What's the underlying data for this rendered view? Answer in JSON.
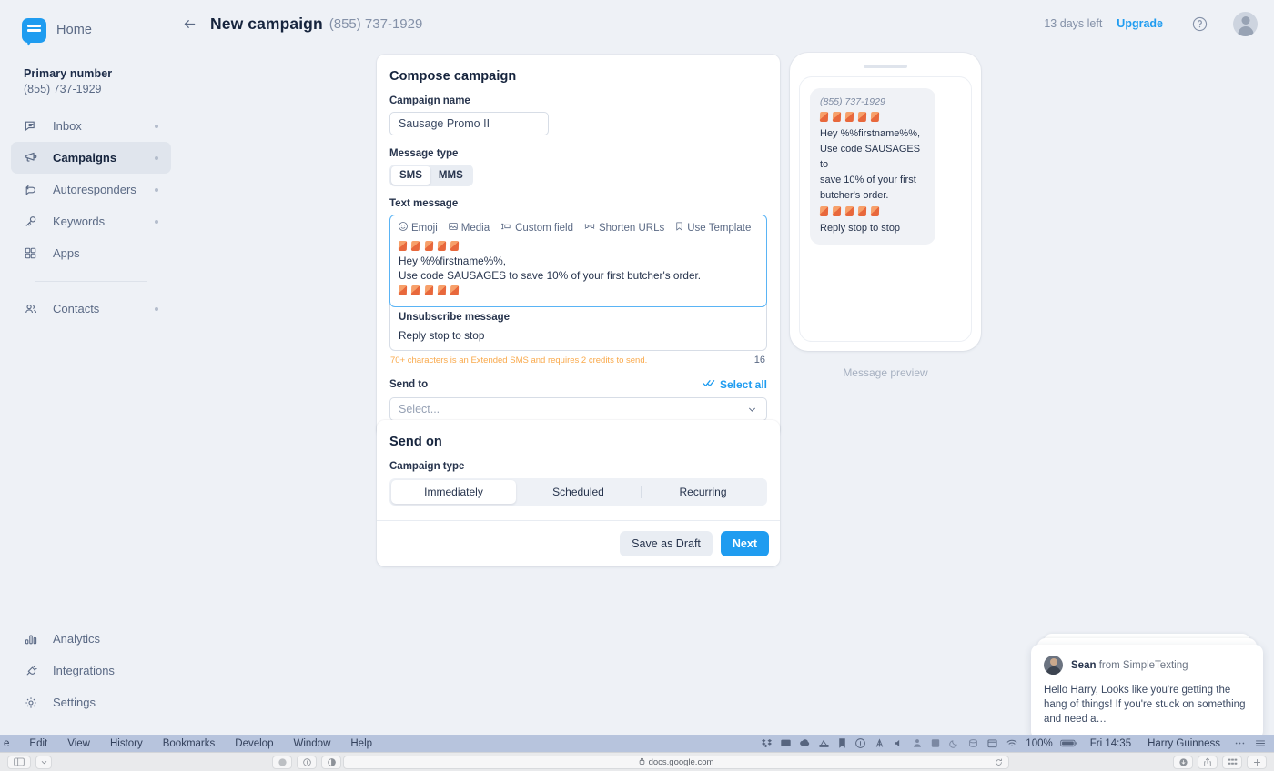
{
  "app": {
    "logo_label": "Home",
    "brand_blue": "#1f9cf0"
  },
  "sidebar": {
    "primary_label": "Primary number",
    "primary_number": "(855) 737-1929",
    "items": [
      {
        "label": "Inbox",
        "icon": "chat-bubble-icon",
        "dot": true,
        "active": false
      },
      {
        "label": "Campaigns",
        "icon": "megaphone-icon",
        "dot": true,
        "active": true
      },
      {
        "label": "Autoresponders",
        "icon": "reply-bubble-icon",
        "dot": true,
        "active": false
      },
      {
        "label": "Keywords",
        "icon": "key-icon",
        "dot": true,
        "active": false
      },
      {
        "label": "Apps",
        "icon": "grid-icon",
        "dot": false,
        "active": false
      }
    ],
    "items_after_divider": [
      {
        "label": "Contacts",
        "icon": "contacts-icon",
        "dot": true,
        "active": false
      }
    ],
    "bottom_items": [
      {
        "label": "Analytics",
        "icon": "bar-chart-icon"
      },
      {
        "label": "Integrations",
        "icon": "plug-icon"
      },
      {
        "label": "Settings",
        "icon": "gear-icon"
      }
    ]
  },
  "topbar": {
    "back_icon": "arrow-left-icon",
    "title": "New campaign",
    "subtitle": "(855) 737-1929",
    "days_left": "13 days left",
    "upgrade": "Upgrade",
    "help_icon": "question-circle-icon",
    "avatar_icon": "user-avatar"
  },
  "compose": {
    "title": "Compose campaign",
    "name_label": "Campaign name",
    "name_value": "Sausage Promo II",
    "name_placeholder": "Campaign name",
    "msgtype_label": "Message type",
    "msgtype_options": [
      "SMS",
      "MMS"
    ],
    "msgtype_selected": "SMS",
    "text_label": "Text message",
    "tools": [
      {
        "label": "Emoji",
        "icon": "smiley-icon"
      },
      {
        "label": "Media",
        "icon": "image-icon"
      },
      {
        "label": "Custom field",
        "icon": "custom-field-icon"
      },
      {
        "label": "Shorten URLs",
        "icon": "link-icon"
      },
      {
        "label": "Use Template",
        "icon": "bookmark-icon"
      }
    ],
    "message_emoji_top_count": 5,
    "message_line1": "Hey %%firstname%%,",
    "message_line2": "Use code SAUSAGES to save 10% of your first butcher's order.",
    "message_emoji_bottom_count": 5,
    "unsubscribe_label": "Unsubscribe message",
    "unsubscribe_value": "Reply stop to stop",
    "warning": "70+ characters is an Extended SMS and requires 2 credits to send.",
    "warning_color": "#f9a94b",
    "counter": "16",
    "sendto_label": "Send to",
    "select_all": "Select all",
    "select_all_icon": "double-check-icon",
    "sendto_placeholder": "Select...",
    "sendto_chevron": "chevron-down-icon"
  },
  "sendon": {
    "title": "Send on",
    "type_label": "Campaign type",
    "type_options": [
      "Immediately",
      "Scheduled",
      "Recurring"
    ],
    "type_selected": "Immediately",
    "save_draft": "Save as Draft",
    "next": "Next"
  },
  "preview": {
    "from": "(855) 737-1929",
    "emoji_top_count": 5,
    "line1": "Hey %%firstname%%,",
    "line2": "Use code SAUSAGES to",
    "line3": "save 10% of your first",
    "line4": "butcher's order.",
    "emoji_bottom_count": 5,
    "line5": "Reply stop to stop",
    "caption": "Message preview"
  },
  "chat": {
    "sender_name": "Sean",
    "sender_suffix": "from SimpleTexting",
    "message": "Hello Harry, Looks like you're getting the hang of things! If you're stuck on something and need a…"
  },
  "macos": {
    "menus": [
      "e",
      "Edit",
      "View",
      "History",
      "Bookmarks",
      "Develop",
      "Window",
      "Help"
    ],
    "status_icons": [
      "dropbox-icon",
      "display-icon",
      "cloud-icon",
      "scanner-icon",
      "bookmark-icon",
      "info-circle-icon",
      "antenna-icon",
      "volume-icon",
      "user-icon",
      "sublime-icon",
      "moon-icon",
      "database-icon",
      "calendar-icon",
      "wifi-icon"
    ],
    "battery": "100%",
    "battery_icon": "battery-icon",
    "clock": "Fri 14:35",
    "user": "Harry Guinness",
    "overflow_icon": "ellipsis-icon",
    "list_icon": "control-center-icon"
  },
  "browser": {
    "sidebar_icon": "sidebar-icon",
    "sidebar_chevron": "chevron-down-icon",
    "ext_icons": [
      "extension-globe-icon",
      "extension-circle-icon",
      "extension-contrast-icon"
    ],
    "lock_icon": "lock-icon",
    "url": "docs.google.com",
    "reload_icon": "reload-icon",
    "right_icons": [
      "download-icon",
      "share-icon",
      "tab-overview-icon",
      "new-tab-icon"
    ]
  }
}
